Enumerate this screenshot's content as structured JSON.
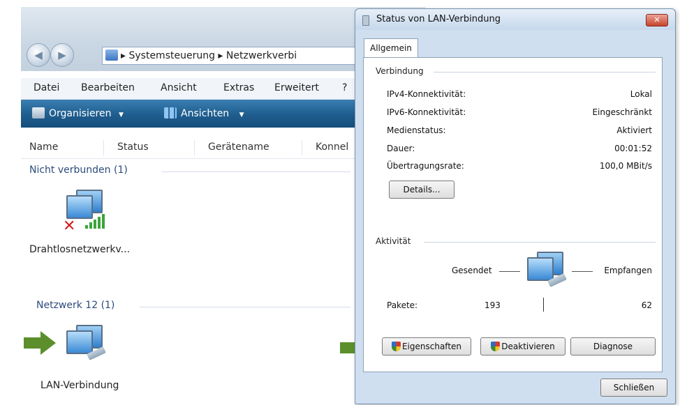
{
  "explorer": {
    "nav": {
      "back": "◀",
      "forward": "▶"
    },
    "address": {
      "sep": "▸",
      "crumbs": [
        "Systemsteuerung",
        "Netzwerkverbi"
      ]
    },
    "menu": [
      "Datei",
      "Bearbeiten",
      "Ansicht",
      "Extras",
      "Erweitert",
      "?"
    ],
    "toolbar": {
      "organize": "Organisieren",
      "views": "Ansichten",
      "dropdown": "▼"
    },
    "columns": [
      "Name",
      "Status",
      "Gerätename",
      "Konnel"
    ],
    "groups": [
      {
        "title": "Nicht verbunden (1)",
        "item_label": "Drahtlosnetzwerkv..."
      },
      {
        "title": "Netzwerk 12 (1)",
        "item_label": "LAN-Verbindung"
      }
    ],
    "colors": {
      "arrow": "#5c8f2c",
      "group_text": "#2c4b7c"
    }
  },
  "dialog": {
    "title": "Status von LAN-Verbindung",
    "close": "✕",
    "tab": "Allgemein",
    "connection": {
      "section": "Verbindung",
      "rows": [
        {
          "label": "IPv4-Konnektivität:",
          "value": "Lokal"
        },
        {
          "label": "IPv6-Konnektivität:",
          "value": "Eingeschränkt"
        },
        {
          "label": "Medienstatus:",
          "value": "Aktiviert"
        },
        {
          "label": "Dauer:",
          "value": "00:01:52"
        },
        {
          "label": "Übertragungsrate:",
          "value": "100,0 MBit/s"
        }
      ],
      "details_button": "Details..."
    },
    "activity": {
      "section": "Aktivität",
      "sent_label": "Gesendet",
      "received_label": "Empfangen",
      "packets_label": "Pakete:",
      "packets_sent": "193",
      "packets_received": "62"
    },
    "buttons": {
      "properties": "Eigenschaften",
      "deactivate": "Deaktivieren",
      "diagnose": "Diagnose",
      "close": "Schließen"
    }
  }
}
